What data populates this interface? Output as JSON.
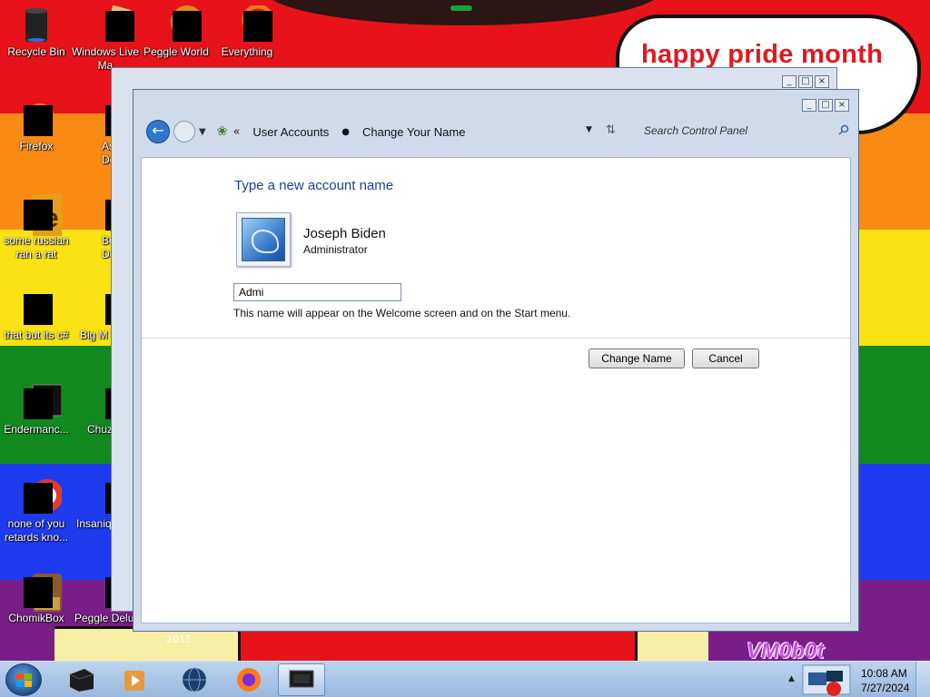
{
  "wallpaper": {
    "banner_text": "happy pride month",
    "corner_text": "VM0b0t",
    "year_text": "2015"
  },
  "desktop_icons": [
    {
      "label": "Recycle Bin",
      "icon": "recycle-bin-icon"
    },
    {
      "label": "Windows Live Ma",
      "icon": "windows-live-icon"
    },
    {
      "label": "Peggle World",
      "icon": "peggle-icon"
    },
    {
      "label": "Everything",
      "icon": "everything-icon"
    },
    {
      "label": "Firefox",
      "icon": "firefox-icon"
    },
    {
      "label": "Astro Delu",
      "icon": "game-icon"
    },
    {
      "label": "some russian ran a rat",
      "icon": "app-icon"
    },
    {
      "label": "Bejew Delu",
      "icon": "game-icon"
    },
    {
      "label": "that but its c#",
      "icon": "app-icon"
    },
    {
      "label": "Big M Delu",
      "icon": "game-icon"
    },
    {
      "label": "Endermanc...",
      "icon": "app-icon"
    },
    {
      "label": "Chuz Delu",
      "icon": "game-icon"
    },
    {
      "label": "none of you retards kno...",
      "icon": "app-icon"
    },
    {
      "label": "Insaniq Delu",
      "icon": "game-icon"
    },
    {
      "label": "ChomikBox",
      "icon": "chomikbox-icon"
    },
    {
      "label": "Peggle Delu",
      "icon": "peggle-icon"
    }
  ],
  "window": {
    "breadcrumb": [
      "User Accounts",
      "Change Your Name"
    ],
    "search_placeholder": "Search Control Panel",
    "heading": "Type a new account name",
    "user_name": "Joseph Biden",
    "user_role": "Administrator",
    "name_value": "Admi",
    "hint": "This name will appear on the Welcome screen and on the Start menu.",
    "change_button": "Change Name",
    "cancel_button": "Cancel",
    "title_buttons": [
      "_",
      "□",
      "×"
    ]
  },
  "taskbar": {
    "items": [
      "explorer-icon",
      "media-player-icon",
      "globe-icon",
      "firefox-icon",
      "control-panel-icon"
    ],
    "time": "10:08 AM",
    "date": "7/27/2024"
  }
}
